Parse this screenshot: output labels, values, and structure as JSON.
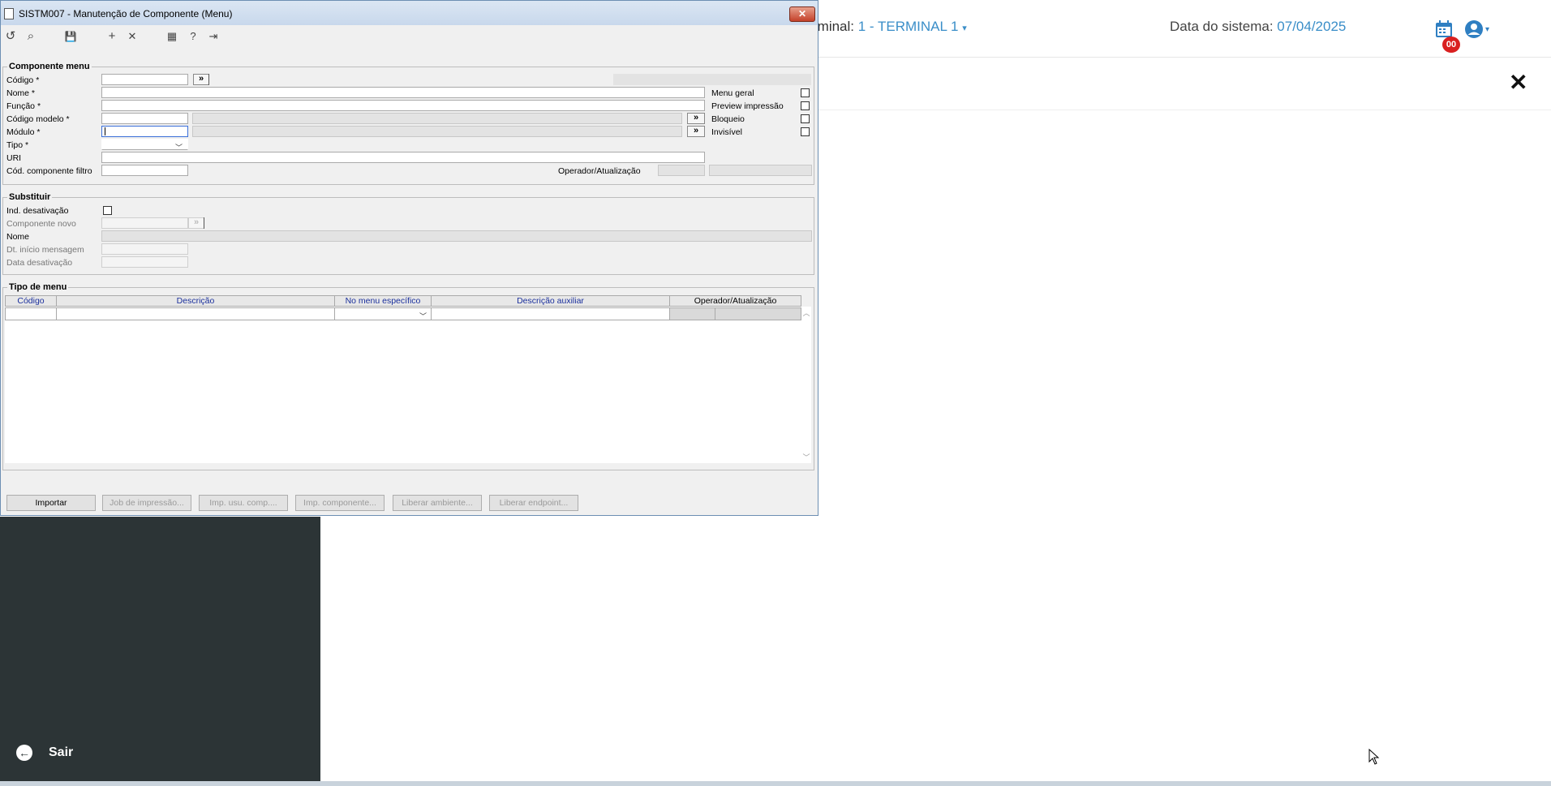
{
  "background": {
    "terminal_label": "rminal:",
    "terminal_value": "1 - TERMINAL 1",
    "date_label": "Data do sistema:",
    "date_value": "07/04/2025",
    "notification_count": "00",
    "sidebar_exit": "Sair",
    "accent_color": "#3a8ec8",
    "sidebar_color": "#2c3436",
    "icons": [
      "calendar-icon",
      "user-icon",
      "close-icon",
      "exit-arrow-icon"
    ]
  },
  "dialog": {
    "title": "SISTM007 - Manutenção de Componente (Menu)",
    "close_label": "✕",
    "toolbar": [
      {
        "name": "undo-icon",
        "glyph": "↺"
      },
      {
        "name": "search-icon",
        "glyph": "⌕"
      },
      {
        "name": "save-icon",
        "glyph": "💾"
      },
      {
        "name": "add-icon",
        "glyph": "+"
      },
      {
        "name": "delete-icon",
        "glyph": "✕"
      },
      {
        "name": "calendar-icon",
        "glyph": "▦"
      },
      {
        "name": "help-icon",
        "glyph": "?"
      },
      {
        "name": "exit-icon",
        "glyph": "⇥"
      }
    ],
    "componente_menu": {
      "legend": "Componente menu",
      "codigo": "Código *",
      "nome": "Nome *",
      "funcao": "Função *",
      "codigo_modelo": "Código modelo *",
      "modulo": "Módulo *",
      "tipo": "Tipo *",
      "uri": "URI",
      "cod_componente_filtro": "Cód. componente filtro",
      "operador_atualizacao": "Operador/Atualização",
      "lookup": "»",
      "checks": {
        "menu_geral": "Menu geral",
        "preview_impressao": "Preview impressão",
        "bloqueio": "Bloqueio",
        "invisivel": "Invisível"
      }
    },
    "substituir": {
      "legend": "Substituir",
      "ind_desativacao": "Ind. desativação",
      "componente_novo": "Componente novo",
      "nome": "Nome",
      "dt_inicio_mensagem": "Dt. início mensagem",
      "data_desativacao": "Data desativação"
    },
    "tipo_de_menu": {
      "legend": "Tipo de menu",
      "columns": [
        "Código",
        "Descrição",
        "No menu específico",
        "Descrição auxiliar",
        "Operador/Atualização"
      ]
    },
    "buttons": {
      "importar": "Importar",
      "job_impressao": "Job de impressão...",
      "imp_usu_comp": "Imp. usu. comp....",
      "imp_componente": "Imp. componente...",
      "liberar_ambiente": "Liberar ambiente...",
      "liberar_endpoint": "Liberar endpoint..."
    }
  }
}
